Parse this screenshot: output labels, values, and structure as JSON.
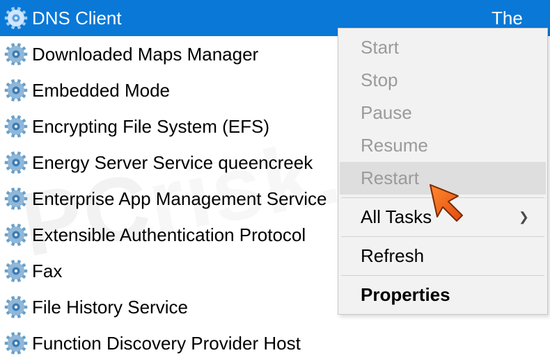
{
  "watermark": {
    "left": "PC",
    "right": "risk.com"
  },
  "columns": {
    "description_fragment": "The"
  },
  "services": [
    {
      "label": "DNS Client",
      "selected": true
    },
    {
      "label": "Downloaded Maps Manager",
      "selected": false
    },
    {
      "label": "Embedded Mode",
      "selected": false
    },
    {
      "label": "Encrypting File System (EFS)",
      "selected": false
    },
    {
      "label": "Energy Server Service queencreek",
      "selected": false
    },
    {
      "label": "Enterprise App Management Service",
      "selected": false
    },
    {
      "label": "Extensible Authentication Protocol",
      "selected": false
    },
    {
      "label": "Fax",
      "selected": false
    },
    {
      "label": "File History Service",
      "selected": false
    },
    {
      "label": "Function Discovery Provider Host",
      "selected": false
    }
  ],
  "context_menu": {
    "start": "Start",
    "stop": "Stop",
    "pause": "Pause",
    "resume": "Resume",
    "restart": "Restart",
    "all_tasks": "All Tasks",
    "refresh": "Refresh",
    "properties": "Properties"
  }
}
